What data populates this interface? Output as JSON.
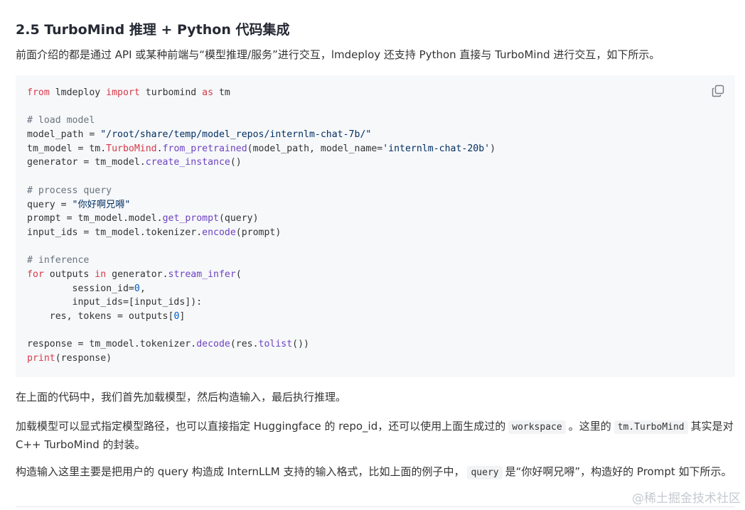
{
  "section": {
    "title": "2.5 TurboMind 推理 + Python 代码集成"
  },
  "intro": "前面介绍的都是通过 API 或某种前端与“模型推理/服务”进行交互，lmdeploy 还支持 Python 直接与 TurboMind 进行交互，如下所示。",
  "code": {
    "copy_icon": "copy-icon",
    "lines": [
      [
        {
          "t": "from",
          "c": "kw"
        },
        {
          "t": " lmdeploy "
        },
        {
          "t": "import",
          "c": "kw"
        },
        {
          "t": " turbomind "
        },
        {
          "t": "as",
          "c": "kw"
        },
        {
          "t": " tm"
        }
      ],
      [],
      [
        {
          "t": "# load model",
          "c": "cm"
        }
      ],
      [
        {
          "t": "model_path = "
        },
        {
          "t": "\"/root/share/temp/model_repos/internlm-chat-7b/\"",
          "c": "st"
        }
      ],
      [
        {
          "t": "tm_model = tm."
        },
        {
          "t": "TurboMind",
          "c": "kw"
        },
        {
          "t": "."
        },
        {
          "t": "from_pretrained",
          "c": "fn"
        },
        {
          "t": "(model_path, model_name="
        },
        {
          "t": "'internlm-chat-20b'",
          "c": "st"
        },
        {
          "t": ")"
        }
      ],
      [
        {
          "t": "generator = tm_model."
        },
        {
          "t": "create_instance",
          "c": "fn"
        },
        {
          "t": "()"
        }
      ],
      [],
      [
        {
          "t": "# process query",
          "c": "cm"
        }
      ],
      [
        {
          "t": "query = "
        },
        {
          "t": "\"你好啊兄嘚\"",
          "c": "st"
        }
      ],
      [
        {
          "t": "prompt = tm_model.model."
        },
        {
          "t": "get_prompt",
          "c": "fn"
        },
        {
          "t": "(query)"
        }
      ],
      [
        {
          "t": "input_ids = tm_model.tokenizer."
        },
        {
          "t": "encode",
          "c": "fn"
        },
        {
          "t": "(prompt)"
        }
      ],
      [],
      [
        {
          "t": "# inference",
          "c": "cm"
        }
      ],
      [
        {
          "t": "for",
          "c": "kw"
        },
        {
          "t": " outputs "
        },
        {
          "t": "in",
          "c": "kw"
        },
        {
          "t": " generator."
        },
        {
          "t": "stream_infer",
          "c": "fn"
        },
        {
          "t": "("
        }
      ],
      [
        {
          "t": "        session_id="
        },
        {
          "t": "0",
          "c": "nm"
        },
        {
          "t": ","
        }
      ],
      [
        {
          "t": "        input_ids=[input_ids]):"
        }
      ],
      [
        {
          "t": "    res, tokens = outputs["
        },
        {
          "t": "0",
          "c": "nm"
        },
        {
          "t": "]"
        }
      ],
      [],
      [
        {
          "t": "response = tm_model.tokenizer."
        },
        {
          "t": "decode",
          "c": "fn"
        },
        {
          "t": "(res."
        },
        {
          "t": "tolist",
          "c": "fn"
        },
        {
          "t": "())"
        }
      ],
      [
        {
          "t": "print",
          "c": "kw"
        },
        {
          "t": "(response)"
        }
      ]
    ]
  },
  "para2": "在上面的代码中，我们首先加载模型，然后构造输入，最后执行推理。",
  "para3": {
    "part1": "加载模型可以显式指定模型路径，也可以直接指定 Huggingface 的 repo_id，还可以使用上面生成过的",
    "code1": "workspace",
    "part2": "。这里的",
    "code2": "tm.TurboMind",
    "part3": "其实是对 C++ TurboMind 的封装。"
  },
  "para4": {
    "part1": "构造输入这里主要是把用户的 query 构造成 InternLLM 支持的输入格式，比如上面的例子中，",
    "code1": "query",
    "part2": "是“你好啊兄嘚”，构造好的 Prompt 如下所示。"
  },
  "watermark": "@稀土掘金技术社区"
}
